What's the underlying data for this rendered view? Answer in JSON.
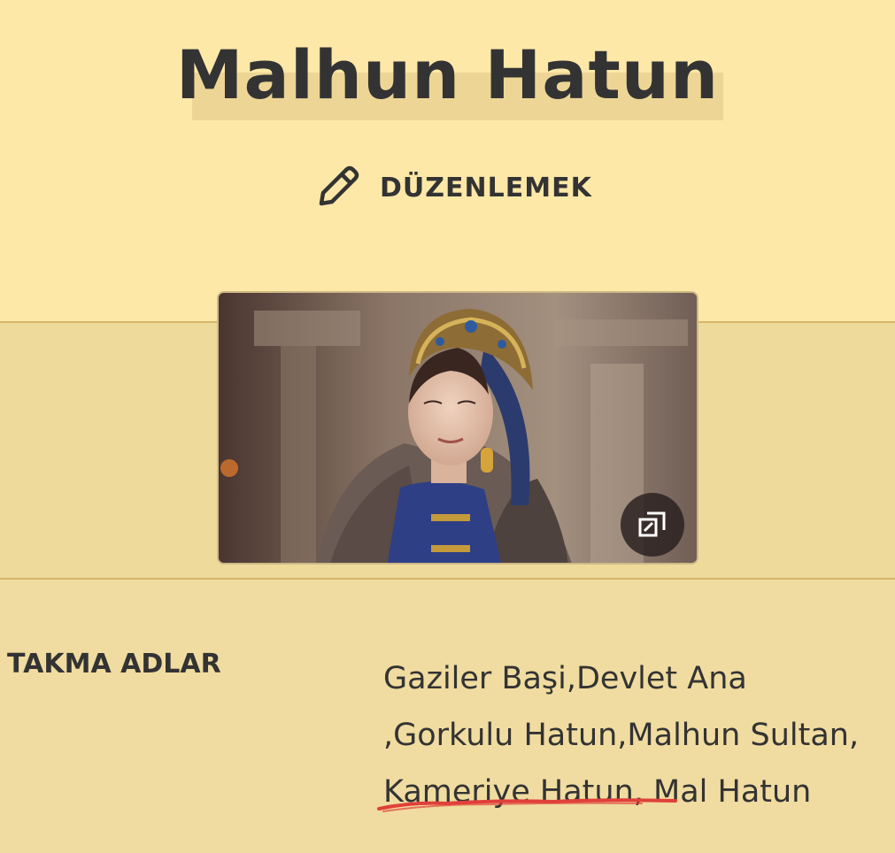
{
  "page": {
    "title": "Malhun Hatun",
    "edit_label": "DÜZENLEMEK"
  },
  "image": {
    "alt": "Malhun Hatun",
    "expand_icon": "expand-icon"
  },
  "info": {
    "nicknames_label": "TAKMA ADLAR",
    "nicknames_lines": [
      "Gaziler Başi,Devlet Ana",
      ",Gorkulu Hatun,Malhun Sultan,",
      "Kameriye Hatun, Mal Hatun"
    ]
  },
  "colors": {
    "background": "#fde8a8",
    "band": "#eedb9c",
    "divider": "#d7b668",
    "text": "#333333",
    "underline": "#e0403a"
  }
}
